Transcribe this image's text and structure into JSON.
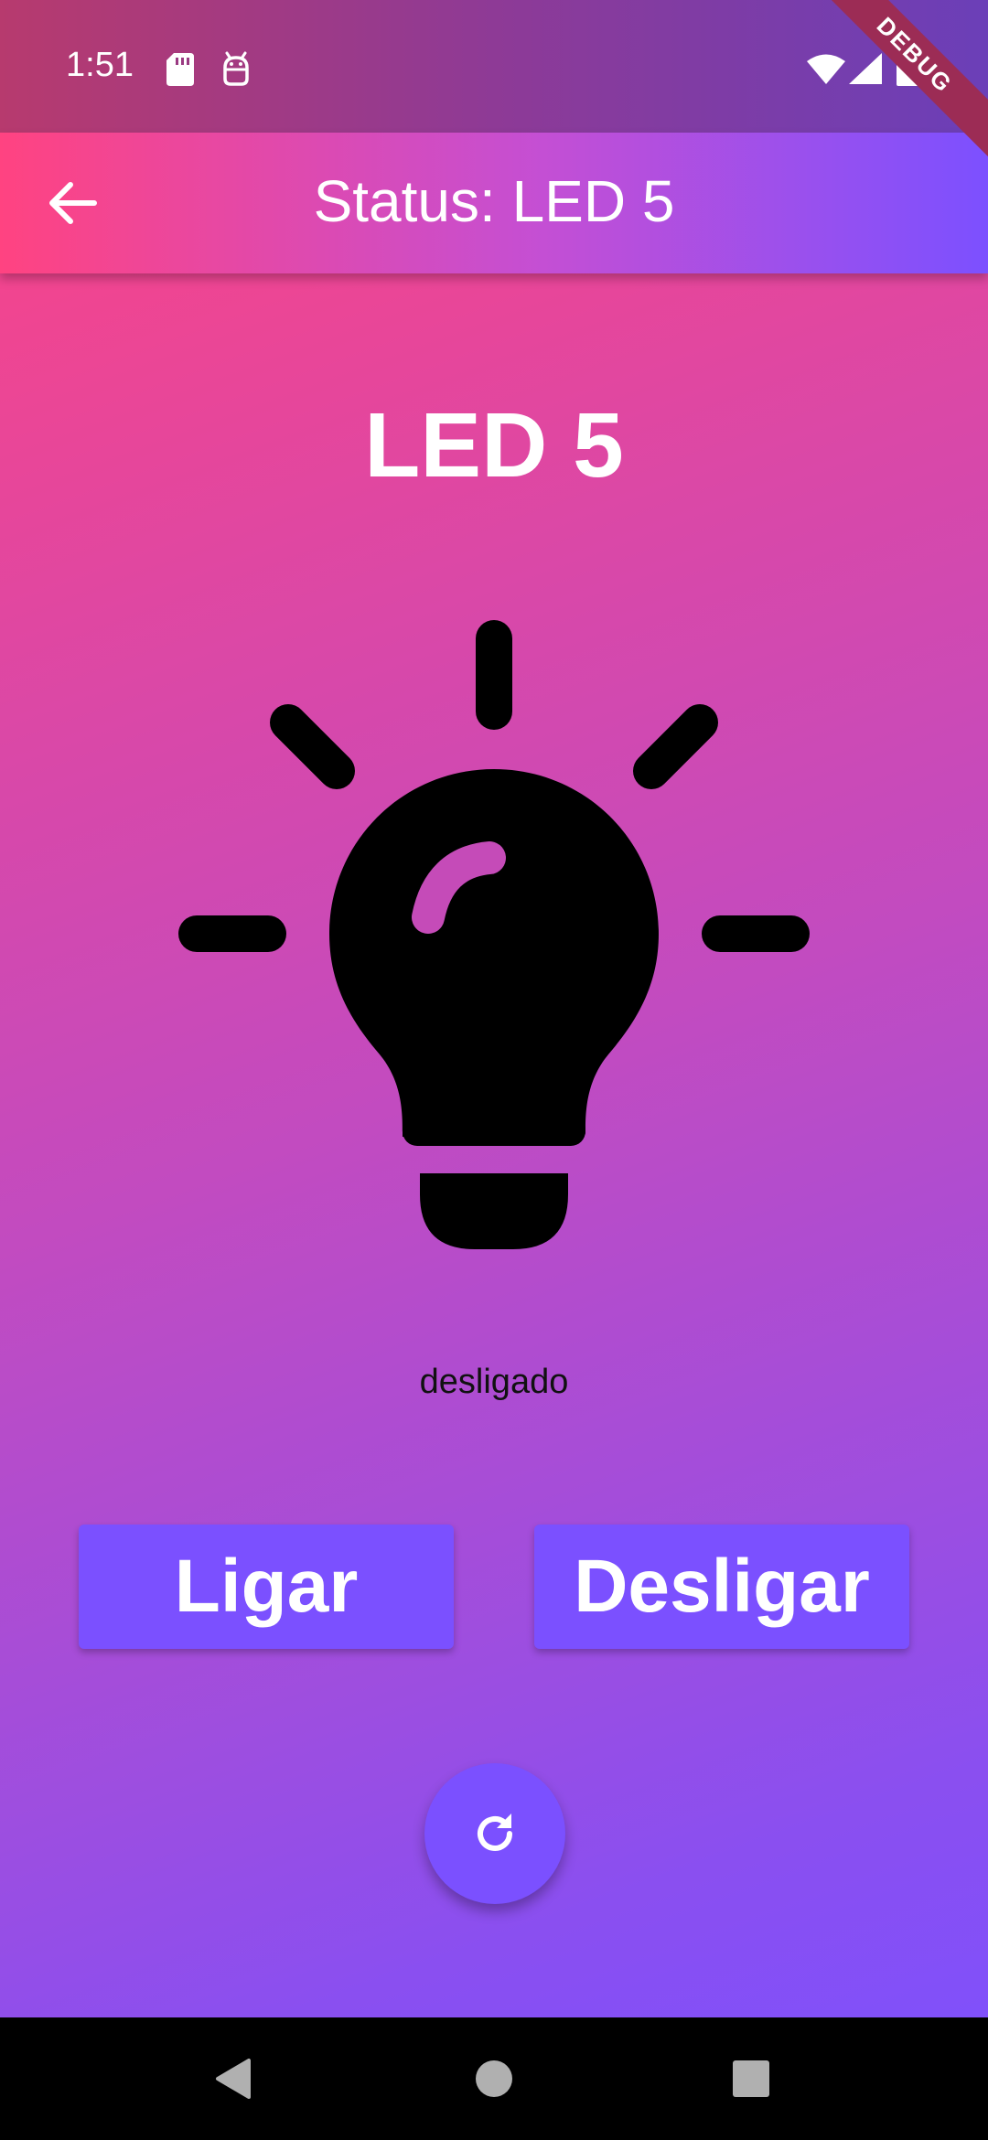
{
  "status_bar": {
    "time": "1:51",
    "icons": [
      "sd-card-icon",
      "android-debug-icon",
      "wifi-icon",
      "cellular-signal-icon",
      "battery-icon"
    ]
  },
  "debug_banner": "DEBUG",
  "app_bar": {
    "title": "Status: LED 5",
    "back_icon": "arrow-back-icon"
  },
  "device": {
    "name": "LED 5",
    "state_text": "desligado",
    "icon": "lightbulb-icon"
  },
  "actions": {
    "on_label": "Ligar",
    "off_label": "Desligar",
    "refresh_icon": "refresh-icon"
  },
  "navigation": {
    "icons": [
      "nav-back-icon",
      "nav-home-icon",
      "nav-recents-icon"
    ]
  },
  "colors": {
    "gradient_start": "#ff4381",
    "gradient_end": "#7c50ff",
    "button": "#7b50ff",
    "text_light": "#ffffff",
    "text_dark": "#111111"
  }
}
